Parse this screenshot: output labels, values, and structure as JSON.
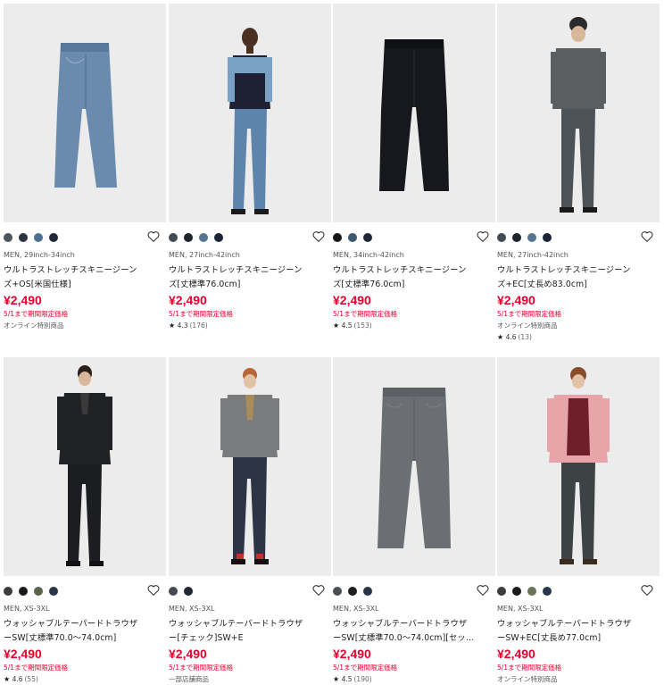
{
  "products": [
    {
      "meta": "MEN, 29inch-34inch",
      "name_line1": "ウルトラストレッチスキニージーン",
      "name_line2": "ズ+OS[米国仕様]",
      "price": "¥2,490",
      "promo": "5/1まで期間限定価格",
      "note": "オンライン特別商品",
      "rating": "",
      "reviews": "",
      "colors": [
        "#4a5560",
        "#2a3442",
        "#4e6f8f",
        "#1f2a3a"
      ],
      "image_icon": "jeans-icon"
    },
    {
      "meta": "MEN, 27inch-42inch",
      "name_line1": "ウルトラストレッチスキニージーン",
      "name_line2": "ズ[丈標準76.0cm]",
      "price": "¥2,490",
      "promo": "5/1まで期間限定価格",
      "note": "",
      "rating": "4.3",
      "reviews": "(176)",
      "colors": [
        "#444b52",
        "#1d2430",
        "#55768f",
        "#1a2434"
      ],
      "image_icon": "model-icon"
    },
    {
      "meta": "MEN, 34inch-42inch",
      "name_line1": "ウルトラストレッチスキニージーン",
      "name_line2": "ズ[丈標準76.0cm]",
      "price": "¥2,490",
      "promo": "5/1まで期間限定価格",
      "note": "",
      "rating": "4.5",
      "reviews": "(153)",
      "colors": [
        "#141414",
        "#3e5670",
        "#1e2838"
      ],
      "image_icon": "jeans-icon"
    },
    {
      "meta": "MEN, 27inch-42inch",
      "name_line1": "ウルトラストレッチスキニージーン",
      "name_line2": "ズ+EC[丈長め83.0cm]",
      "price": "¥2,490",
      "promo": "5/1まで期間限定価格",
      "note": "オンライン特別商品",
      "rating": "4.6",
      "reviews": "(13)",
      "colors": [
        "#444b52",
        "#1d2430",
        "#55768f",
        "#1a2434"
      ],
      "image_icon": "model-icon"
    },
    {
      "meta": "MEN, XS-3XL",
      "name_line1": "ウォッシャブルテーパードトラウザ",
      "name_line2": "ーSW[丈標準70.0〜74.0cm]",
      "price": "¥2,490",
      "promo": "5/1まで期間限定価格",
      "note": "",
      "rating": "4.6",
      "reviews": "(55)",
      "colors": [
        "#3c3c3c",
        "#1a1a1a",
        "#59624a",
        "#28344a"
      ],
      "image_icon": "model-icon"
    },
    {
      "meta": "MEN, XS-3XL",
      "name_line1": "ウォッシャブルテーパードトラウザ",
      "name_line2": "ー[チェック]SW+E",
      "price": "¥2,490",
      "promo": "5/1まで期間限定価格",
      "note": "一部店舗商品",
      "rating": "",
      "reviews": "",
      "colors": [
        "#454a50",
        "#1e2533"
      ],
      "image_icon": "model-icon"
    },
    {
      "meta": "MEN, XS-3XL",
      "name_line1": "ウォッシャブルテーパードトラウザ",
      "name_line2": "ーSW[丈標準70.0〜74.0cm][セッ…",
      "price": "¥2,490",
      "promo": "5/1まで期間限定価格",
      "note": "",
      "rating": "4.5",
      "reviews": "(190)",
      "colors": [
        "#4c4f53",
        "#1d1d1f",
        "#28344a"
      ],
      "image_icon": "trousers-icon"
    },
    {
      "meta": "MEN, XS-3XL",
      "name_line1": "ウォッシャブルテーパードトラウザ",
      "name_line2": "ーSW+EC[丈長め77.0cm]",
      "price": "¥2,490",
      "promo": "5/1まで期間限定価格",
      "note": "オンライン特別商品",
      "rating": "",
      "reviews": "",
      "colors": [
        "#3c3c3c",
        "#1a1a1a",
        "#6b7257",
        "#28344a"
      ],
      "image_icon": "model-icon"
    }
  ],
  "icons": {
    "favorite": "heart-outline-icon",
    "rating": "star-icon"
  },
  "rating_star": "★"
}
